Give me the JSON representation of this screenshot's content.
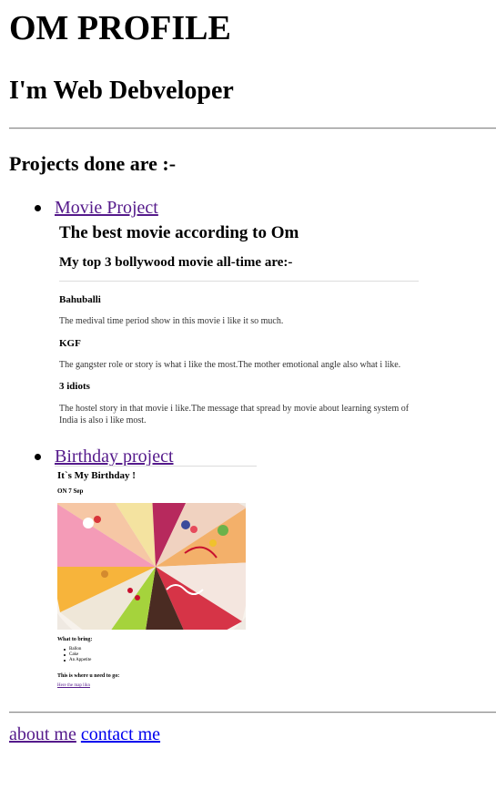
{
  "header": {
    "title": "OM PROFILE",
    "subtitle": "I'm Web Debveloper"
  },
  "projects": {
    "heading": "Projects done are :-",
    "items": [
      {
        "label": "Movie Project"
      },
      {
        "label": "Birthday project"
      }
    ]
  },
  "movie_page": {
    "title": "The best movie according to Om",
    "subtitle": "My top 3 bollywood movie all-time are:-",
    "movies": [
      {
        "name": "Bahuballi",
        "description": "The medival time period show in this movie i like it so much."
      },
      {
        "name": "KGF",
        "description": "The gangster role or story is what i like the most.The mother emotional angle also what i like."
      },
      {
        "name": "3 idiots",
        "description": "The hostel story in that movie i like.The message that spread by movie about learning system of India is also i like most."
      }
    ]
  },
  "birthday_page": {
    "title": "It`s My Birthday !",
    "date": "ON 7 Sep",
    "image_icon": "cake-slices-photo",
    "what_to_bring": "What to bring:",
    "bring_items": [
      "Ballon",
      "Cake",
      "An Appetite"
    ],
    "where_heading": "This is where u need to go:",
    "map_link": "Here the map likn"
  },
  "footer": {
    "about_label": "about me",
    "contact_label": "contact me"
  },
  "colors": {
    "visited_link": "#551a8b",
    "unvisited_link": "#0000ee",
    "rule": "#8a8a8a"
  }
}
